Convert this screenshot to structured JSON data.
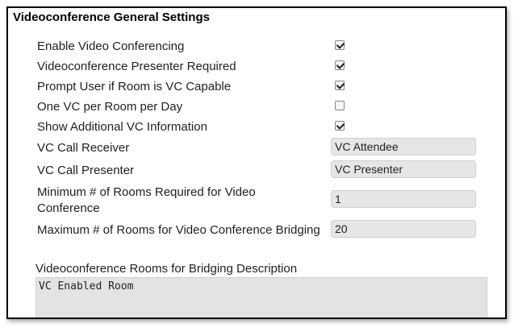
{
  "section": {
    "title": "Videoconference General Settings"
  },
  "settings": [
    {
      "label": "Enable Video Conferencing",
      "checked": true
    },
    {
      "label": "Videoconference Presenter Required",
      "checked": true
    },
    {
      "label": "Prompt User if Room is VC Capable",
      "checked": true
    },
    {
      "label": "One VC per Room per Day",
      "checked": false
    },
    {
      "label": "Show Additional VC Information",
      "checked": true
    }
  ],
  "fields": {
    "call_receiver": {
      "label": "VC Call Receiver",
      "value": "VC Attendee"
    },
    "call_presenter": {
      "label": "VC Call Presenter",
      "value": "VC Presenter"
    },
    "min_rooms": {
      "label": "Minimum # of Rooms Required for Video Conference",
      "value": "1"
    },
    "max_rooms": {
      "label": "Maximum # of Rooms for Video Conference Bridging",
      "value": "20"
    }
  },
  "bridging_description": {
    "label": "Videoconference Rooms for Bridging Description",
    "value": "VC Enabled Room"
  }
}
